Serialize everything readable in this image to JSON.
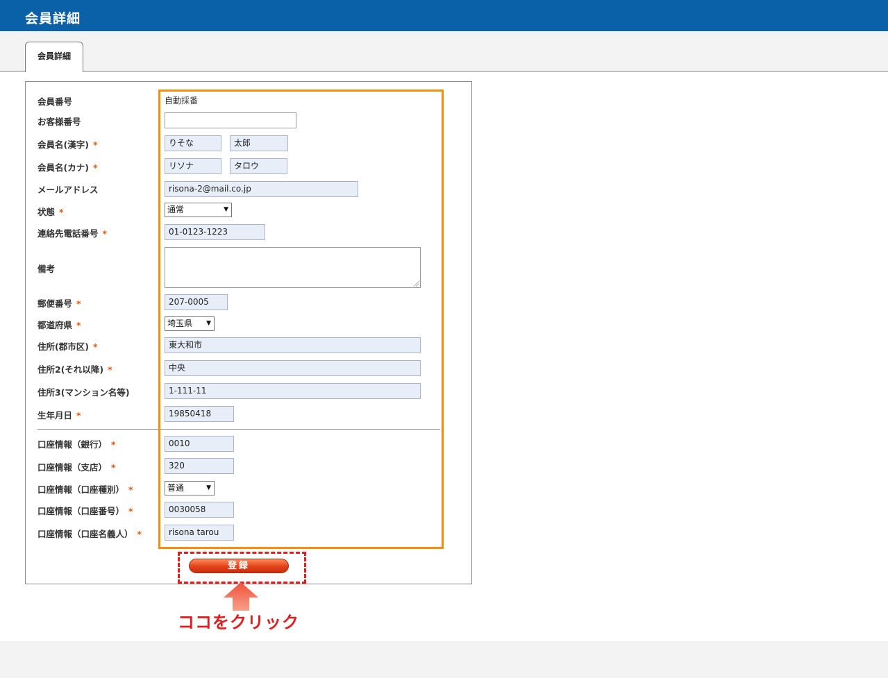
{
  "header": {
    "title": "会員詳細"
  },
  "tabs": [
    {
      "label": "会員詳細"
    }
  ],
  "form": {
    "member_no": {
      "label": "会員番号",
      "value": "自動採番"
    },
    "customer_no": {
      "label": "お客様番号",
      "value": ""
    },
    "name_kanji": {
      "label": "会員名(漢字)",
      "last": "りそな",
      "first": "太郎"
    },
    "name_kana": {
      "label": "会員名(カナ)",
      "last": "リソナ",
      "first": "タロウ"
    },
    "email": {
      "label": "メールアドレス",
      "value": "risona-2@mail.co.jp"
    },
    "status": {
      "label": "状態",
      "value": "通常"
    },
    "phone": {
      "label": "連絡先電話番号",
      "value": "01-0123-1223"
    },
    "note": {
      "label": "備考",
      "value": ""
    },
    "postal": {
      "label": "郵便番号",
      "value": "207-0005"
    },
    "prefecture": {
      "label": "都道府県",
      "value": "埼玉県"
    },
    "address1": {
      "label": "住所(郡市区)",
      "value": "東大和市"
    },
    "address2": {
      "label": "住所2(それ以降)",
      "value": "中央"
    },
    "address3": {
      "label": "住所3(マンション名等)",
      "value": "1-111-11"
    },
    "birthday": {
      "label": "生年月日",
      "value": "19850418"
    },
    "bank": {
      "label": "口座情報（銀行）",
      "value": "0010"
    },
    "branch": {
      "label": "口座情報（支店）",
      "value": "320"
    },
    "account_type": {
      "label": "口座情報（口座種別）",
      "value": "普通"
    },
    "account_no": {
      "label": "口座情報（口座番号）",
      "value": "0030058"
    },
    "account_name": {
      "label": "口座情報（口座名義人）",
      "value": "risona tarou"
    },
    "required_mark": "*",
    "submit_label": "登録"
  },
  "annotation": {
    "callout": "ココをクリック"
  },
  "colors": {
    "header_bg": "#0b61a8",
    "highlight": "#f0900e",
    "callout": "#e11d1d",
    "required": "#e05a10",
    "button": "#e2421a"
  }
}
